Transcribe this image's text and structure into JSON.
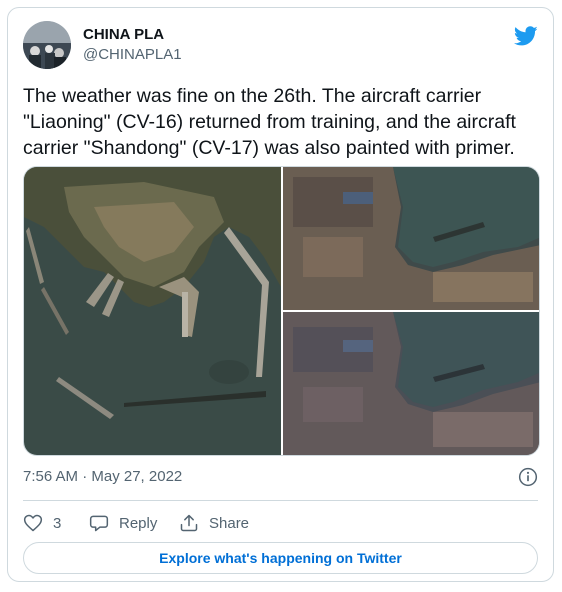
{
  "tweet": {
    "author_name": "CHINA PLA",
    "author_handle": "@CHINAPLA1",
    "text": "The weather was fine on the 26th. The aircraft carrier \"Liaoning\" (CV-16) returned from training, and the aircraft carrier \"Shandong\" (CV-17) was also painted with primer.",
    "timestamp": "7:56 AM · May 27, 2022",
    "like_count": "3",
    "reply_label": "Reply",
    "share_label": "Share",
    "explore_label": "Explore what's happening on Twitter"
  },
  "colors": {
    "brand": "#1d9bf0",
    "link": "#006fd6",
    "secondary_text": "#536471",
    "border": "#cfd9de"
  },
  "icons": [
    "twitter-bird-icon",
    "info-icon",
    "heart-icon",
    "reply-icon",
    "share-icon"
  ]
}
